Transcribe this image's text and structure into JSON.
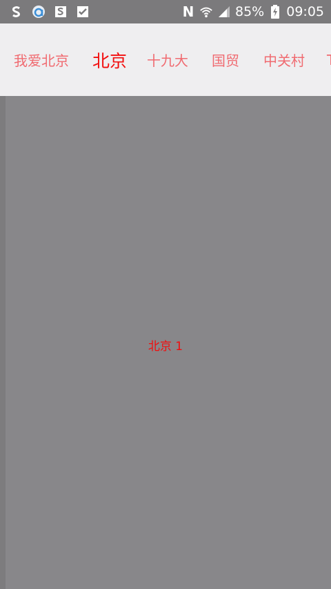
{
  "status_bar": {
    "left_icons": [
      "s-app-icon",
      "browser-icon",
      "s-note-icon",
      "check-icon"
    ],
    "nfc_label": "N",
    "battery_percent": "85%",
    "time": "09:05"
  },
  "tabs": [
    {
      "label": "我爱北京",
      "active": false
    },
    {
      "label": "北京",
      "active": true
    },
    {
      "label": "十九大",
      "active": false
    },
    {
      "label": "国贸",
      "active": false
    },
    {
      "label": "中关村",
      "active": false
    },
    {
      "label": "T",
      "active": false
    }
  ],
  "colors": {
    "tab_inactive": "#f06a70",
    "tab_active": "#f20d0d",
    "tab_bar_bg": "#efeef0",
    "content_bg": "#88878a"
  },
  "content": {
    "page_label": "北京 1"
  }
}
